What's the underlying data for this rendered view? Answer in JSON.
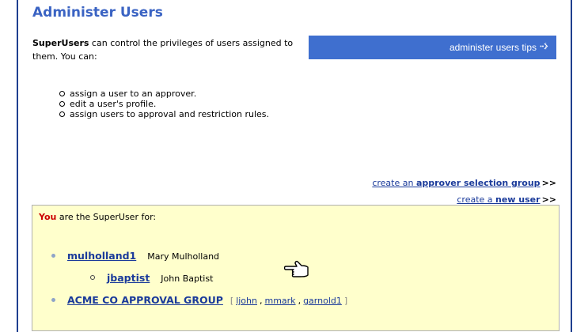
{
  "page": {
    "title": "Administer Users",
    "intro_bold": "SuperUsers",
    "intro_rest": " can control the privileges of users assigned to them. You can:",
    "tips_label": "administer users tips",
    "tips_icon": "arrow-cross-icon",
    "capabilities": [
      "assign a user to an approver.",
      "edit a user's profile.",
      "assign users to approval and restriction rules."
    ]
  },
  "actions": {
    "approver_group_prefix": "create an ",
    "approver_group_bold": "approver selection group",
    "new_user_prefix": "create a ",
    "new_user_bold": "new user",
    "arrows": ">>"
  },
  "superuser": {
    "you": "You",
    "heading_rest": " are the SuperUser for:",
    "users": [
      {
        "username": "mulholland1",
        "fullname": "Mary Mulholland"
      },
      {
        "username": "jbaptist",
        "fullname": "John Baptist"
      }
    ],
    "group": {
      "name": "ACME CO APPROVAL GROUP",
      "open_bracket": "[",
      "close_bracket": "]",
      "members": [
        "ljohn",
        "mmark",
        "garnold1"
      ],
      "separator": ","
    }
  },
  "colors": {
    "accent": "#3a63c3",
    "tips_bar": "#3f6fcf",
    "box_bg": "#ffffcc",
    "you_red": "#cc0000"
  }
}
